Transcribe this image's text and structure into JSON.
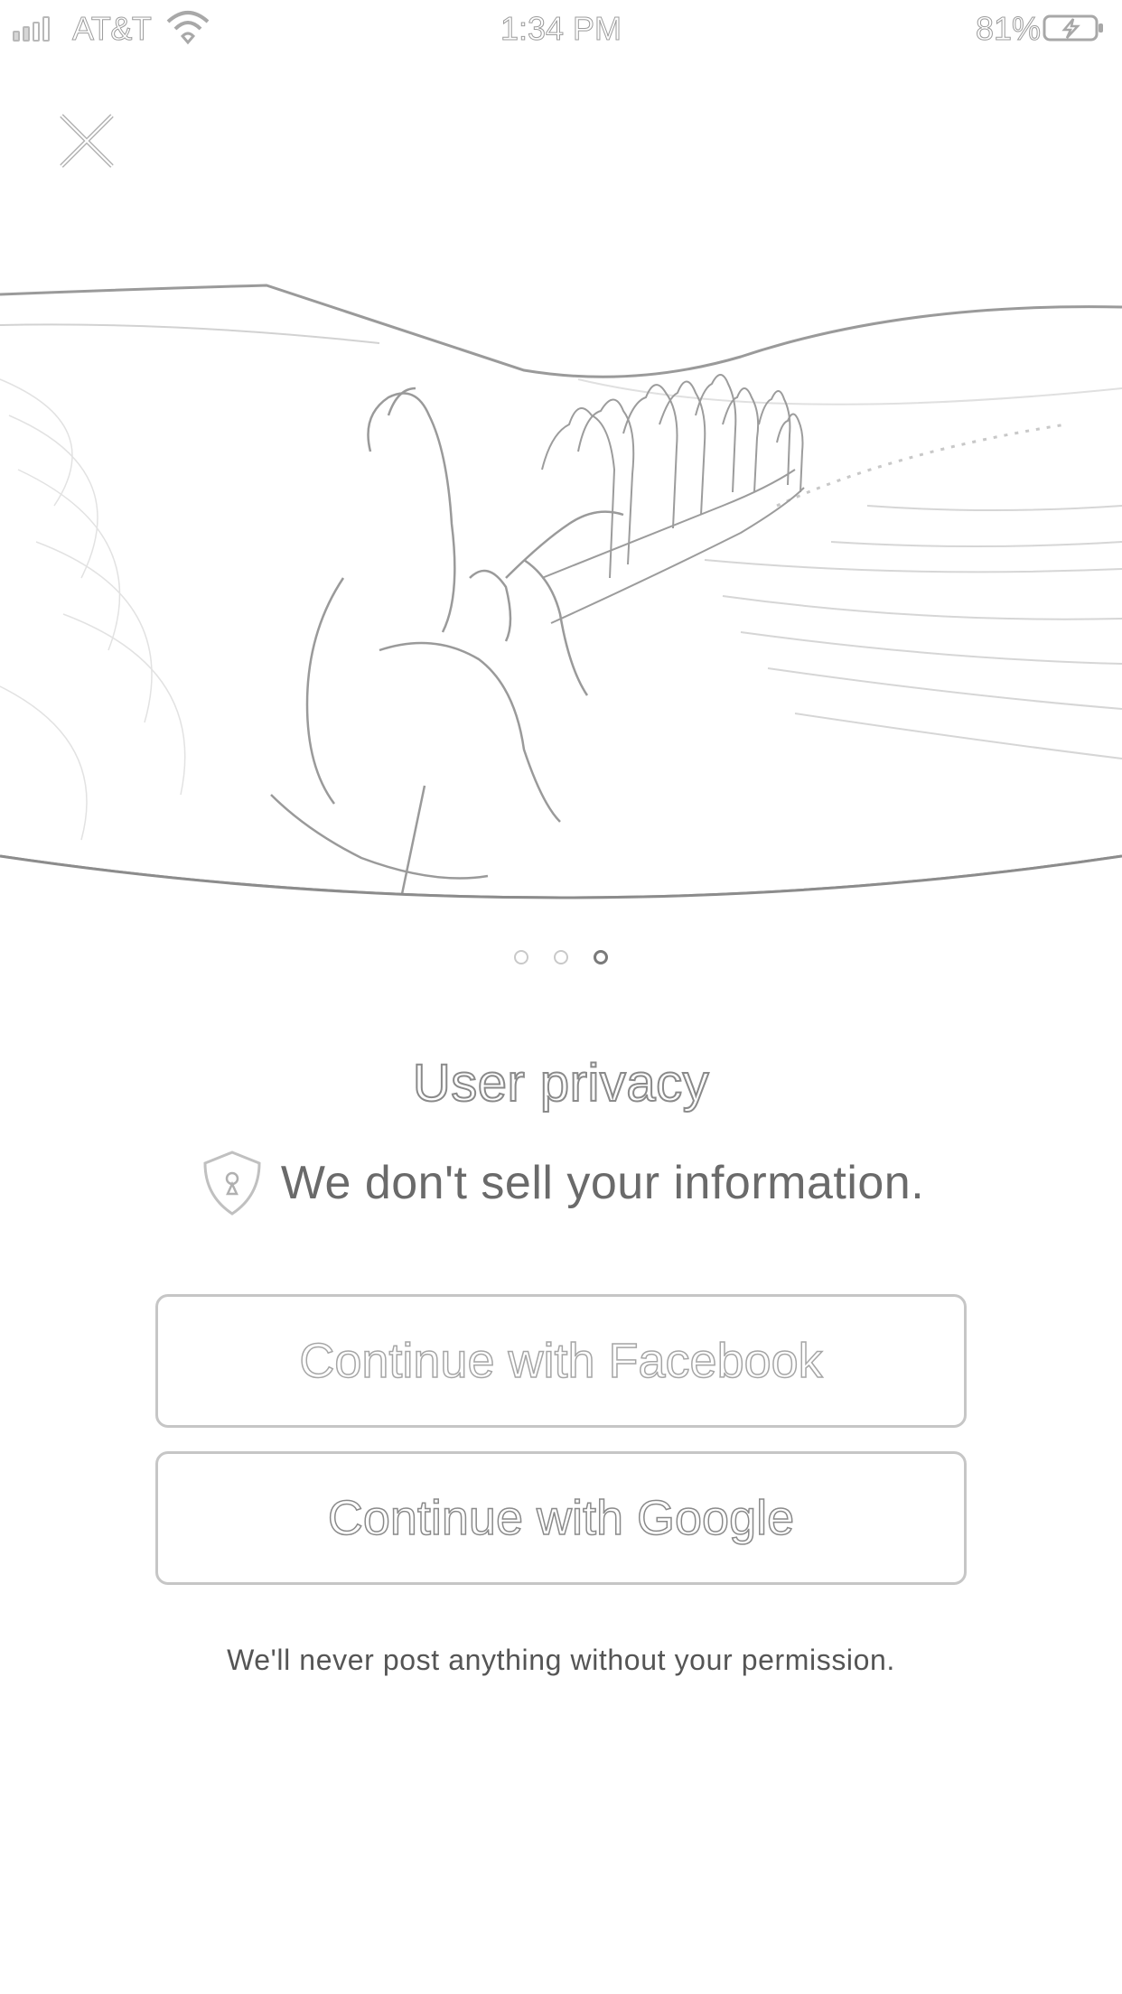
{
  "status_bar": {
    "carrier": "AT&T",
    "time": "1:34 PM",
    "battery_percent": "81%",
    "icons": [
      "signal-icon",
      "wifi-icon",
      "battery-charging-icon"
    ]
  },
  "hero": {
    "image": "desert-camel-caravan-photo",
    "close_icon": "close-icon"
  },
  "pager": {
    "total": 3,
    "active_index": 2
  },
  "content": {
    "title": "User privacy",
    "privacy_icon": "shield-lock-icon",
    "privacy_text": "We don't sell your information."
  },
  "buttons": {
    "facebook_label": "Continue with Facebook",
    "google_label": "Continue with Google"
  },
  "footnote": "We'll never post anything without your permission.",
  "colors": {
    "background": "#ffffff",
    "text": "#6a6a6a",
    "border": "#c6c6c6",
    "active_dot": "#7a7a7a"
  }
}
